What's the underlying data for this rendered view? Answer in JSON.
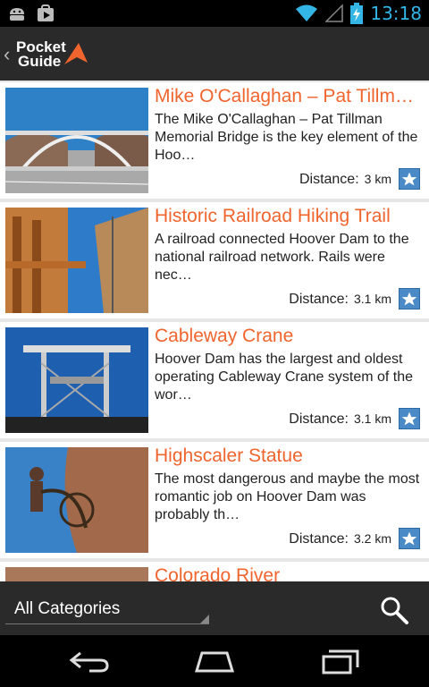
{
  "status_bar": {
    "time": "13:18",
    "icons": [
      "android-notification-icon",
      "play-store-icon",
      "wifi-icon",
      "signal-icon",
      "battery-icon"
    ]
  },
  "action_bar": {
    "logo_line1": "Pocket",
    "logo_line2": "Guide",
    "accent_color": "#f0642e"
  },
  "list": {
    "items": [
      {
        "title": "Mike O'Callaghan – Pat Tillman Memorial Bridge",
        "description": "The Mike O'Callaghan – Pat Tillman Memorial Bridge is the key element of the Hoo…",
        "distance_label": "Distance:",
        "distance_value": "3 km"
      },
      {
        "title": "Historic Railroad Hiking Trail",
        "description": "A railroad connected Hoover Dam to the national railroad network. Rails were nec…",
        "distance_label": "Distance:",
        "distance_value": "3.1 km"
      },
      {
        "title": "Cableway Crane",
        "description": "Hoover Dam has the largest and oldest operating Cableway Crane system of the wor…",
        "distance_label": "Distance:",
        "distance_value": "3.1 km"
      },
      {
        "title": "Highscaler Statue",
        "description": "The most dangerous and maybe the most romantic job on Hoover Dam was probably th…",
        "distance_label": "Distance:",
        "distance_value": "3.2 km"
      },
      {
        "title": "Colorado River"
      }
    ]
  },
  "bottom_bar": {
    "category_selected": "All Categories"
  },
  "nav": {
    "buttons": [
      "back-icon",
      "home-icon",
      "recent-apps-icon"
    ]
  }
}
